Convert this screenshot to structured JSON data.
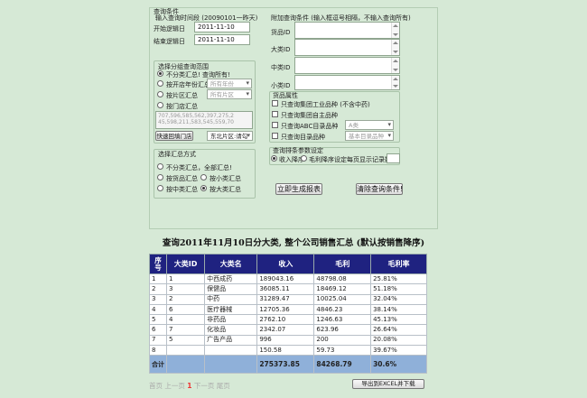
{
  "query": {
    "legend": "查询条件",
    "date_section_label": "输入查询时间段 (20090101一昨天)",
    "start_date_label": "开始逻辑日",
    "start_date_value": "2011-11-10",
    "end_date_label": "结束逻辑日",
    "end_date_value": "2011-11-10",
    "extra_label": "附加查询条件 (输入框逗号相隔，不输入查询所有)",
    "goods_id_label": "货品ID",
    "big_cat_label": "大类ID",
    "mid_cat_label": "中类ID",
    "small_cat_label": "小类ID"
  },
  "group": {
    "legend": "选择分组查询范围",
    "options": [
      "不分类汇总! 查询所有!",
      "按开店年份汇总",
      "按片区汇总",
      "按门店汇总"
    ],
    "year_select": "所有年份",
    "region_select": "所有片区",
    "store_list": "707,596,585,562,397,275,2 45,598,211,583,545,559,70",
    "fast_button": "快速回填门店",
    "region_pick": "东北片区:请勾"
  },
  "attrs": {
    "legend": "货品属性",
    "items": [
      "只查询集团工业品种 (不含中药)",
      "只查询集团自主品种",
      "只查询ABC目录品种",
      "只查询目录品种"
    ],
    "abc_select": "A类",
    "base_select": "基本目录品种"
  },
  "summary": {
    "legend": "选择汇总方式",
    "options": [
      "不分类汇总，全部汇总!",
      "按货品汇总",
      "按小类汇总",
      "按中类汇总",
      "按大类汇总"
    ]
  },
  "params": {
    "legend": "查询排条参数设定",
    "sort_income": "收入降序",
    "sort_profit": "毛利降序",
    "page_size_label": "设定每页显示记录数"
  },
  "buttons": {
    "generate": "立即生成报表",
    "clear": "清除查询条件!",
    "export": "导出到EXCEL并下载"
  },
  "report": {
    "title": "查询2011年11月10日分大类, 整个公司销售汇总 (默认按销售降序)",
    "headers": [
      "序号",
      "大类ID",
      "大类名",
      "收入",
      "毛利",
      "毛利率"
    ],
    "rows": [
      [
        "1",
        "1",
        "中西成药",
        "189043.16",
        "48798.08",
        "25.81%"
      ],
      [
        "2",
        "3",
        "保健品",
        "36085.11",
        "18469.12",
        "51.18%"
      ],
      [
        "3",
        "2",
        "中药",
        "31289.47",
        "10025.04",
        "32.04%"
      ],
      [
        "4",
        "6",
        "医疗器械",
        "12705.36",
        "4846.23",
        "38.14%"
      ],
      [
        "5",
        "4",
        "非药品",
        "2762.10",
        "1246.63",
        "45.13%"
      ],
      [
        "6",
        "7",
        "化妆品",
        "2342.07",
        "623.96",
        "26.64%"
      ],
      [
        "7",
        "5",
        "广告产品",
        "996",
        "200",
        "20.08%"
      ],
      [
        "8",
        "",
        "",
        "150.58",
        "59.73",
        "39.67%"
      ]
    ],
    "total": [
      "合计",
      "",
      "",
      "275373.85",
      "84268.79",
      "30.6%"
    ]
  },
  "pager": {
    "first": "首页",
    "prev": "上一页",
    "current": "1",
    "next": "下一页",
    "last": "尾页"
  }
}
